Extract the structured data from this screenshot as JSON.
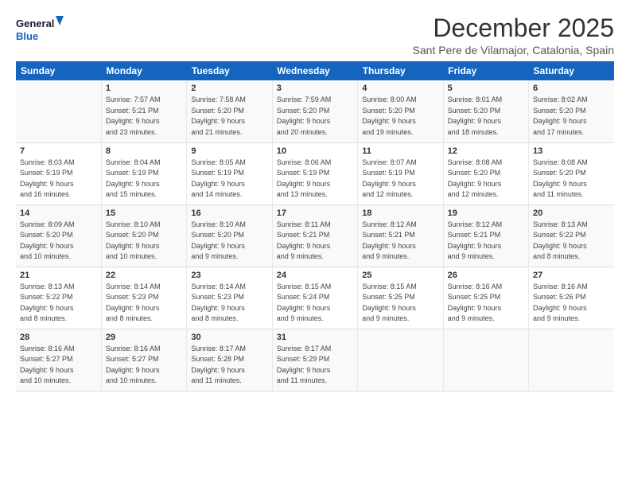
{
  "logo": {
    "line1": "General",
    "line2": "Blue"
  },
  "title": "December 2025",
  "location": "Sant Pere de Vilamajor, Catalonia, Spain",
  "headers": [
    "Sunday",
    "Monday",
    "Tuesday",
    "Wednesday",
    "Thursday",
    "Friday",
    "Saturday"
  ],
  "weeks": [
    [
      {
        "day": "",
        "info": ""
      },
      {
        "day": "1",
        "info": "Sunrise: 7:57 AM\nSunset: 5:21 PM\nDaylight: 9 hours\nand 23 minutes."
      },
      {
        "day": "2",
        "info": "Sunrise: 7:58 AM\nSunset: 5:20 PM\nDaylight: 9 hours\nand 21 minutes."
      },
      {
        "day": "3",
        "info": "Sunrise: 7:59 AM\nSunset: 5:20 PM\nDaylight: 9 hours\nand 20 minutes."
      },
      {
        "day": "4",
        "info": "Sunrise: 8:00 AM\nSunset: 5:20 PM\nDaylight: 9 hours\nand 19 minutes."
      },
      {
        "day": "5",
        "info": "Sunrise: 8:01 AM\nSunset: 5:20 PM\nDaylight: 9 hours\nand 18 minutes."
      },
      {
        "day": "6",
        "info": "Sunrise: 8:02 AM\nSunset: 5:20 PM\nDaylight: 9 hours\nand 17 minutes."
      }
    ],
    [
      {
        "day": "7",
        "info": "Sunrise: 8:03 AM\nSunset: 5:19 PM\nDaylight: 9 hours\nand 16 minutes."
      },
      {
        "day": "8",
        "info": "Sunrise: 8:04 AM\nSunset: 5:19 PM\nDaylight: 9 hours\nand 15 minutes."
      },
      {
        "day": "9",
        "info": "Sunrise: 8:05 AM\nSunset: 5:19 PM\nDaylight: 9 hours\nand 14 minutes."
      },
      {
        "day": "10",
        "info": "Sunrise: 8:06 AM\nSunset: 5:19 PM\nDaylight: 9 hours\nand 13 minutes."
      },
      {
        "day": "11",
        "info": "Sunrise: 8:07 AM\nSunset: 5:19 PM\nDaylight: 9 hours\nand 12 minutes."
      },
      {
        "day": "12",
        "info": "Sunrise: 8:08 AM\nSunset: 5:20 PM\nDaylight: 9 hours\nand 12 minutes."
      },
      {
        "day": "13",
        "info": "Sunrise: 8:08 AM\nSunset: 5:20 PM\nDaylight: 9 hours\nand 11 minutes."
      }
    ],
    [
      {
        "day": "14",
        "info": "Sunrise: 8:09 AM\nSunset: 5:20 PM\nDaylight: 9 hours\nand 10 minutes."
      },
      {
        "day": "15",
        "info": "Sunrise: 8:10 AM\nSunset: 5:20 PM\nDaylight: 9 hours\nand 10 minutes."
      },
      {
        "day": "16",
        "info": "Sunrise: 8:10 AM\nSunset: 5:20 PM\nDaylight: 9 hours\nand 9 minutes."
      },
      {
        "day": "17",
        "info": "Sunrise: 8:11 AM\nSunset: 5:21 PM\nDaylight: 9 hours\nand 9 minutes."
      },
      {
        "day": "18",
        "info": "Sunrise: 8:12 AM\nSunset: 5:21 PM\nDaylight: 9 hours\nand 9 minutes."
      },
      {
        "day": "19",
        "info": "Sunrise: 8:12 AM\nSunset: 5:21 PM\nDaylight: 9 hours\nand 9 minutes."
      },
      {
        "day": "20",
        "info": "Sunrise: 8:13 AM\nSunset: 5:22 PM\nDaylight: 9 hours\nand 8 minutes."
      }
    ],
    [
      {
        "day": "21",
        "info": "Sunrise: 8:13 AM\nSunset: 5:22 PM\nDaylight: 9 hours\nand 8 minutes."
      },
      {
        "day": "22",
        "info": "Sunrise: 8:14 AM\nSunset: 5:23 PM\nDaylight: 9 hours\nand 8 minutes."
      },
      {
        "day": "23",
        "info": "Sunrise: 8:14 AM\nSunset: 5:23 PM\nDaylight: 9 hours\nand 8 minutes."
      },
      {
        "day": "24",
        "info": "Sunrise: 8:15 AM\nSunset: 5:24 PM\nDaylight: 9 hours\nand 9 minutes."
      },
      {
        "day": "25",
        "info": "Sunrise: 8:15 AM\nSunset: 5:25 PM\nDaylight: 9 hours\nand 9 minutes."
      },
      {
        "day": "26",
        "info": "Sunrise: 8:16 AM\nSunset: 5:25 PM\nDaylight: 9 hours\nand 9 minutes."
      },
      {
        "day": "27",
        "info": "Sunrise: 8:16 AM\nSunset: 5:26 PM\nDaylight: 9 hours\nand 9 minutes."
      }
    ],
    [
      {
        "day": "28",
        "info": "Sunrise: 8:16 AM\nSunset: 5:27 PM\nDaylight: 9 hours\nand 10 minutes."
      },
      {
        "day": "29",
        "info": "Sunrise: 8:16 AM\nSunset: 5:27 PM\nDaylight: 9 hours\nand 10 minutes."
      },
      {
        "day": "30",
        "info": "Sunrise: 8:17 AM\nSunset: 5:28 PM\nDaylight: 9 hours\nand 11 minutes."
      },
      {
        "day": "31",
        "info": "Sunrise: 8:17 AM\nSunset: 5:29 PM\nDaylight: 9 hours\nand 11 minutes."
      },
      {
        "day": "",
        "info": ""
      },
      {
        "day": "",
        "info": ""
      },
      {
        "day": "",
        "info": ""
      }
    ]
  ]
}
